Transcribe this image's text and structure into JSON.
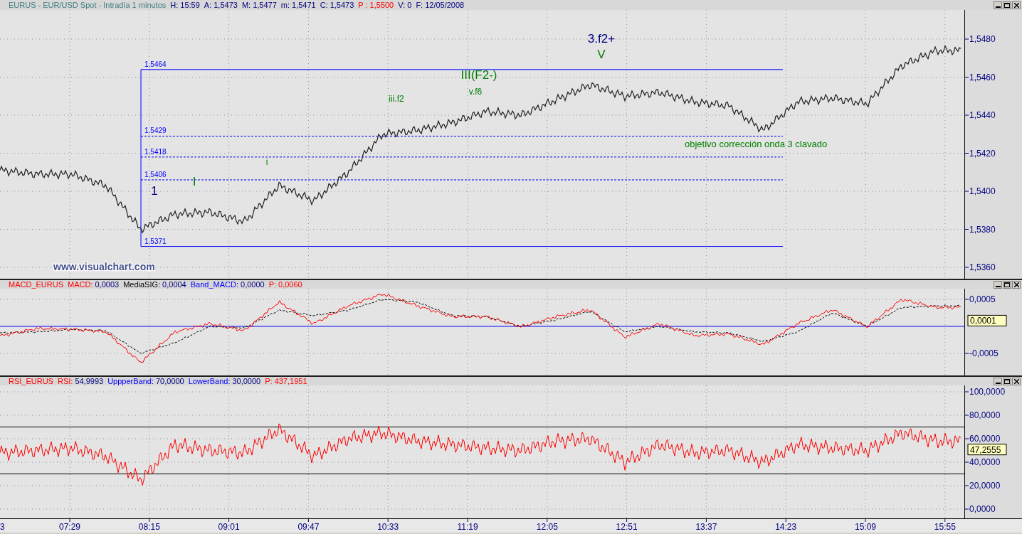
{
  "header": {
    "title": "EURUS - EUR/USD Spot - Intradía 1 minutos",
    "fields": [
      {
        "label": "H:",
        "value": "15:59",
        "kind": "value"
      },
      {
        "label": "A:",
        "value": "1,5473",
        "kind": "value"
      },
      {
        "label": "M:",
        "value": "1,5477",
        "kind": "value"
      },
      {
        "label": "m:",
        "value": "1,5471",
        "kind": "value"
      },
      {
        "label": "C:",
        "value": "1,5473",
        "kind": "value"
      },
      {
        "label": "P :",
        "value": "1,5500",
        "kind": "param"
      },
      {
        "label": "V:",
        "value": "0",
        "kind": "value"
      },
      {
        "label": "F:",
        "value": "12/05/2008",
        "kind": "value"
      }
    ]
  },
  "panes": [
    {
      "kind": "price",
      "logo_text": "www.visualchart.com",
      "fibonacci_levels": [
        "1.5464",
        "1.5429",
        "1.5418",
        "1.5406",
        "1.5371"
      ],
      "wave_labels": [
        "1",
        "I",
        "i",
        "iii.f2",
        "III(F2-)",
        "v.f6",
        "3.f2+",
        "V"
      ],
      "note": "objetivo corrección onda 3 clavado",
      "y_axis_labels": [
        "1,5480",
        "1,5460",
        "1,5440",
        "1,5420",
        "1,5400",
        "1,5380",
        "1,5360"
      ]
    },
    {
      "kind": "macd",
      "header": {
        "name": "MACD_EURUS",
        "color": "#ff0000",
        "fields": [
          {
            "label": "MACD:",
            "value": "0,0003",
            "kind": "value",
            "color": "#ff0000"
          },
          {
            "label": "MediaSIG:",
            "value": "0,0004",
            "kind": "value",
            "color": "#000000"
          },
          {
            "label": "Band_MACD:",
            "value": "0,0000",
            "kind": "value",
            "color": "#0000ff"
          },
          {
            "label": "P:",
            "value": "0,0060",
            "kind": "param",
            "color": "#ff0000"
          }
        ]
      },
      "badge": "0,0001",
      "y_axis_labels": [
        "0,0005",
        "-0,0005"
      ]
    },
    {
      "kind": "rsi",
      "header": {
        "name": "RSI_EURUS",
        "color": "#ff0000",
        "fields": [
          {
            "label": "RSI:",
            "value": "54,9993",
            "kind": "value",
            "color": "#ff0000"
          },
          {
            "label": "UppperBand:",
            "value": "70,0000",
            "kind": "value",
            "color": "#0000ff"
          },
          {
            "label": "LowerBand:",
            "value": "30,0000",
            "kind": "value",
            "color": "#0000ff"
          },
          {
            "label": "P:",
            "value": "437,1951",
            "kind": "param",
            "color": "#ff0000"
          }
        ]
      },
      "badge": "47,2555",
      "y_axis_labels": [
        "100,0000",
        "80,0000",
        "60,0000",
        "40,0000",
        "20,0000",
        "0,0000"
      ]
    }
  ],
  "time_axis": [
    "3",
    "07:29",
    "08:15",
    "09:01",
    "09:47",
    "10:33",
    "11:19",
    "12:05",
    "12:51",
    "13:37",
    "14:23",
    "15:09",
    "15:55"
  ]
}
